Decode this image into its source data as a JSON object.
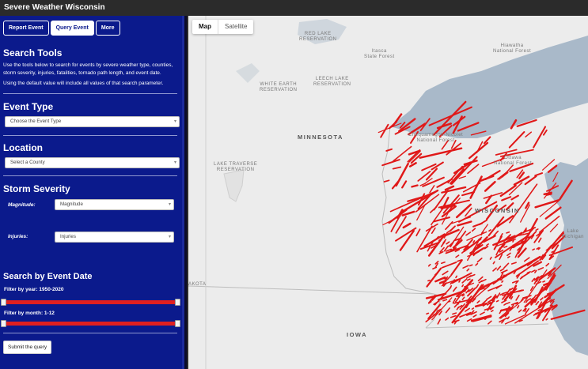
{
  "app_title": "Severe Weather Wisconsin",
  "tabs": [
    {
      "label": "Report Event",
      "active": false
    },
    {
      "label": "Query Event",
      "active": true
    },
    {
      "label": "More",
      "active": false
    }
  ],
  "search_tools": {
    "title": "Search Tools",
    "description": "Use the tools below to search for events by severe weather type, counties, storm severity, injuries, fatalities, tornado path length, and event date.",
    "note": "Using the default value will include all values of that search parameter."
  },
  "event_type": {
    "title": "Event Type",
    "placeholder": "Choose the Event Type"
  },
  "location": {
    "title": "Location",
    "placeholder": "Select a County"
  },
  "storm_severity": {
    "title": "Storm Severity",
    "magnitude_label": "Magnitude:",
    "magnitude_value": "Magnitude",
    "injuries_label": "Injuries:",
    "injuries_value": "Injuries"
  },
  "event_date": {
    "title": "Search by Event Date",
    "year_label": "Filter by year: 1950-2020",
    "month_label": "Filter by month: 1-12"
  },
  "submit_label": "Submit the query",
  "map": {
    "map_button": "Map",
    "satellite_button": "Satellite",
    "labels": {
      "leech_lake": "LEECH LAKE\nRESERVATION",
      "white_earth": "WHITE EARTH\nRESERVATION",
      "red_lake": "RED LAKE\nRESERVATION",
      "minnesota": "MINNESOTA",
      "lake_traverse": "LAKE TRAVERSE\nRESERVATION",
      "wisconsin": "WISCONSIN",
      "iowa": "IOWA",
      "dakota": "AKOTA",
      "nicolet": "Chequamegon-Nicolet\nNational Forest",
      "ottawa": "Ottawa\nNational Forest",
      "hiawatha": "Hiawatha\nNational Forest",
      "itasca": "Itasca\nState Forest",
      "lake_michigan": "Lake\nMichigan"
    }
  },
  "colors": {
    "sidebar": "#0b1a8c",
    "track_line": "#e01818",
    "slider": "#e02020"
  }
}
